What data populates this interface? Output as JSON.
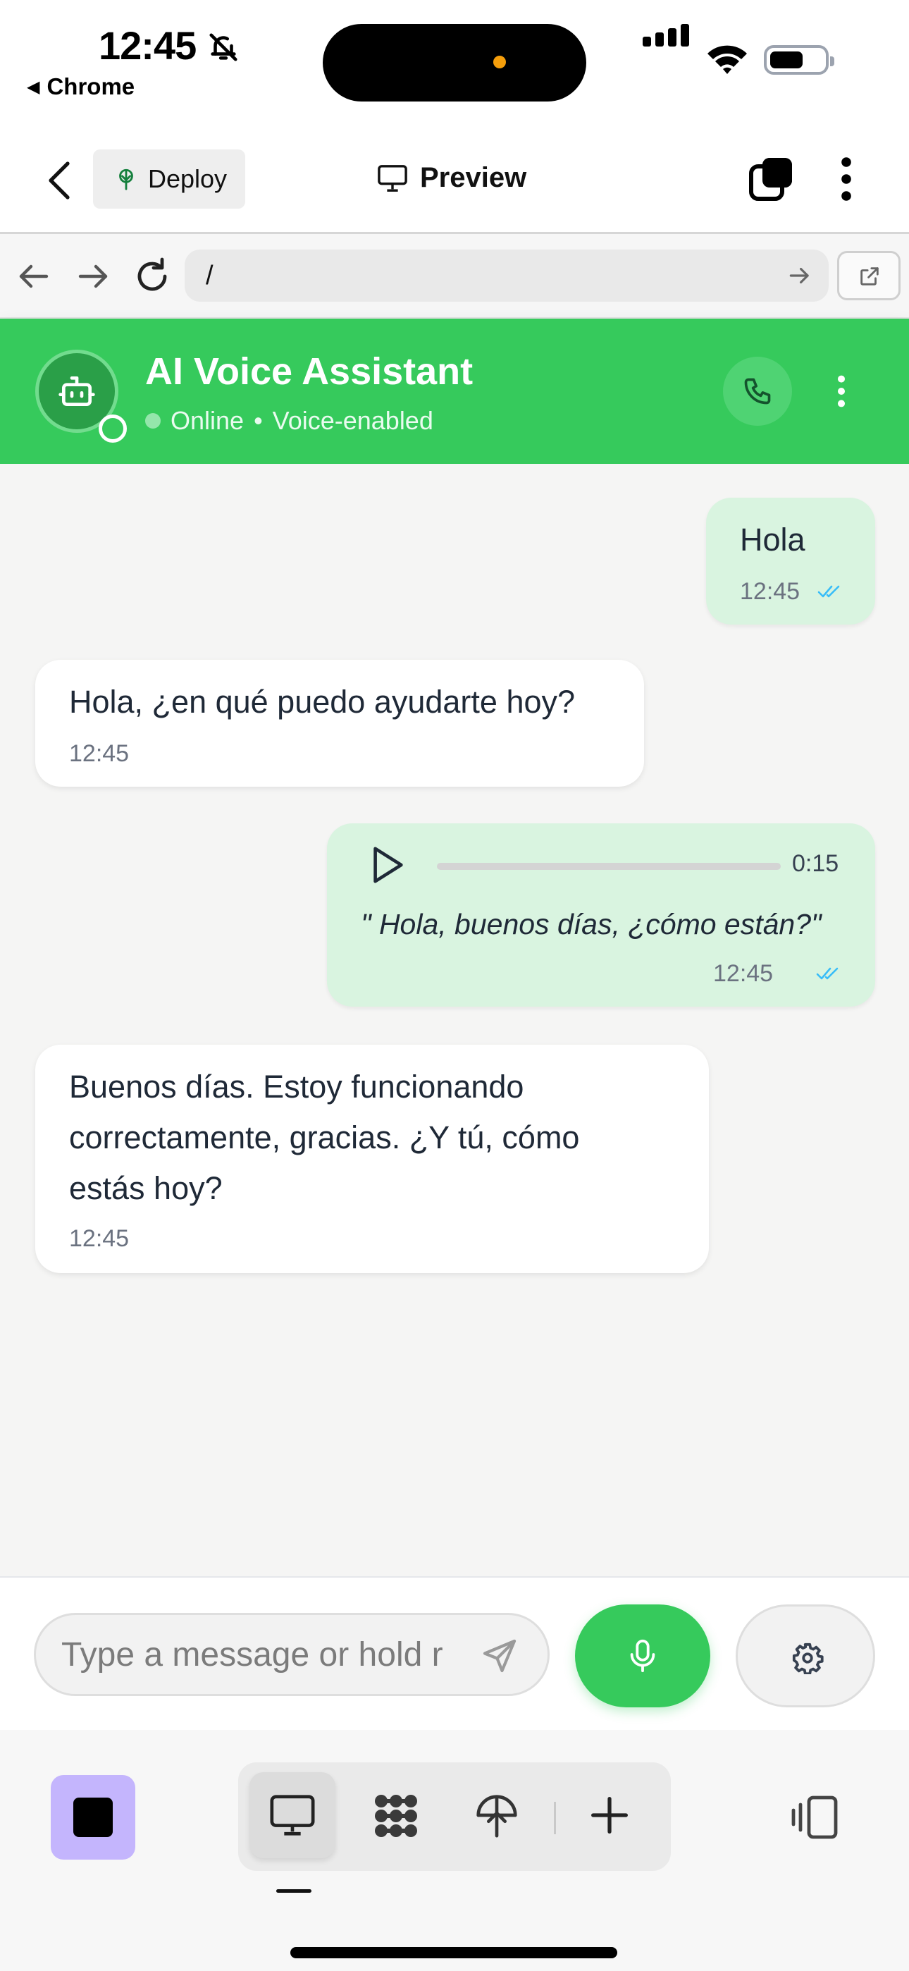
{
  "status_bar": {
    "time": "12:45",
    "back_app": "Chrome"
  },
  "toolbar": {
    "deploy_label": "Deploy",
    "preview_label": "Preview"
  },
  "url_bar": {
    "url": "/"
  },
  "chat_header": {
    "title": "AI Voice Assistant",
    "status": "Online",
    "separator": "•",
    "mode": "Voice-enabled"
  },
  "messages": [
    {
      "direction": "outgoing",
      "type": "text",
      "text": "Hola",
      "time": "12:45",
      "read": true
    },
    {
      "direction": "incoming",
      "type": "text",
      "text": "Hola, ¿en qué puedo ayudarte hoy?",
      "time": "12:45"
    },
    {
      "direction": "outgoing",
      "type": "voice",
      "duration": "0:15",
      "progress": 0,
      "transcript": "\" Hola, buenos días, ¿cómo están?\"",
      "time": "12:45",
      "read": true
    },
    {
      "direction": "incoming",
      "type": "text",
      "lines": [
        "Buenos días. Estoy funcionando",
        "correctamente, gracias. ¿Y tú, cómo",
        "estás hoy?"
      ],
      "time": "12:45"
    }
  ],
  "input": {
    "placeholder": "Type a message or hold r"
  },
  "colors": {
    "brand_green": "#36ca5c",
    "outgoing_bubble": "#d9f4e0",
    "read_ticks": "#38bdf8",
    "stop_button": "#c4b5fd"
  },
  "icons": {
    "toolbar": [
      "chevron-left-icon",
      "deploy-tree-icon",
      "monitor-icon",
      "tabs-icon",
      "more-vertical-icon"
    ],
    "url_bar": [
      "arrow-left-icon",
      "arrow-right-icon",
      "reload-icon",
      "go-arrow-icon",
      "external-link-icon"
    ],
    "chat": [
      "robot-icon",
      "phone-icon",
      "more-vertical-icon",
      "play-icon",
      "double-check-icon",
      "send-icon",
      "microphone-icon",
      "settings-gear-icon"
    ],
    "dock": [
      "stop-icon",
      "monitor-icon",
      "apps-grid-icon",
      "deploy-tree-icon",
      "plus-icon",
      "panel-toggle-icon"
    ]
  }
}
